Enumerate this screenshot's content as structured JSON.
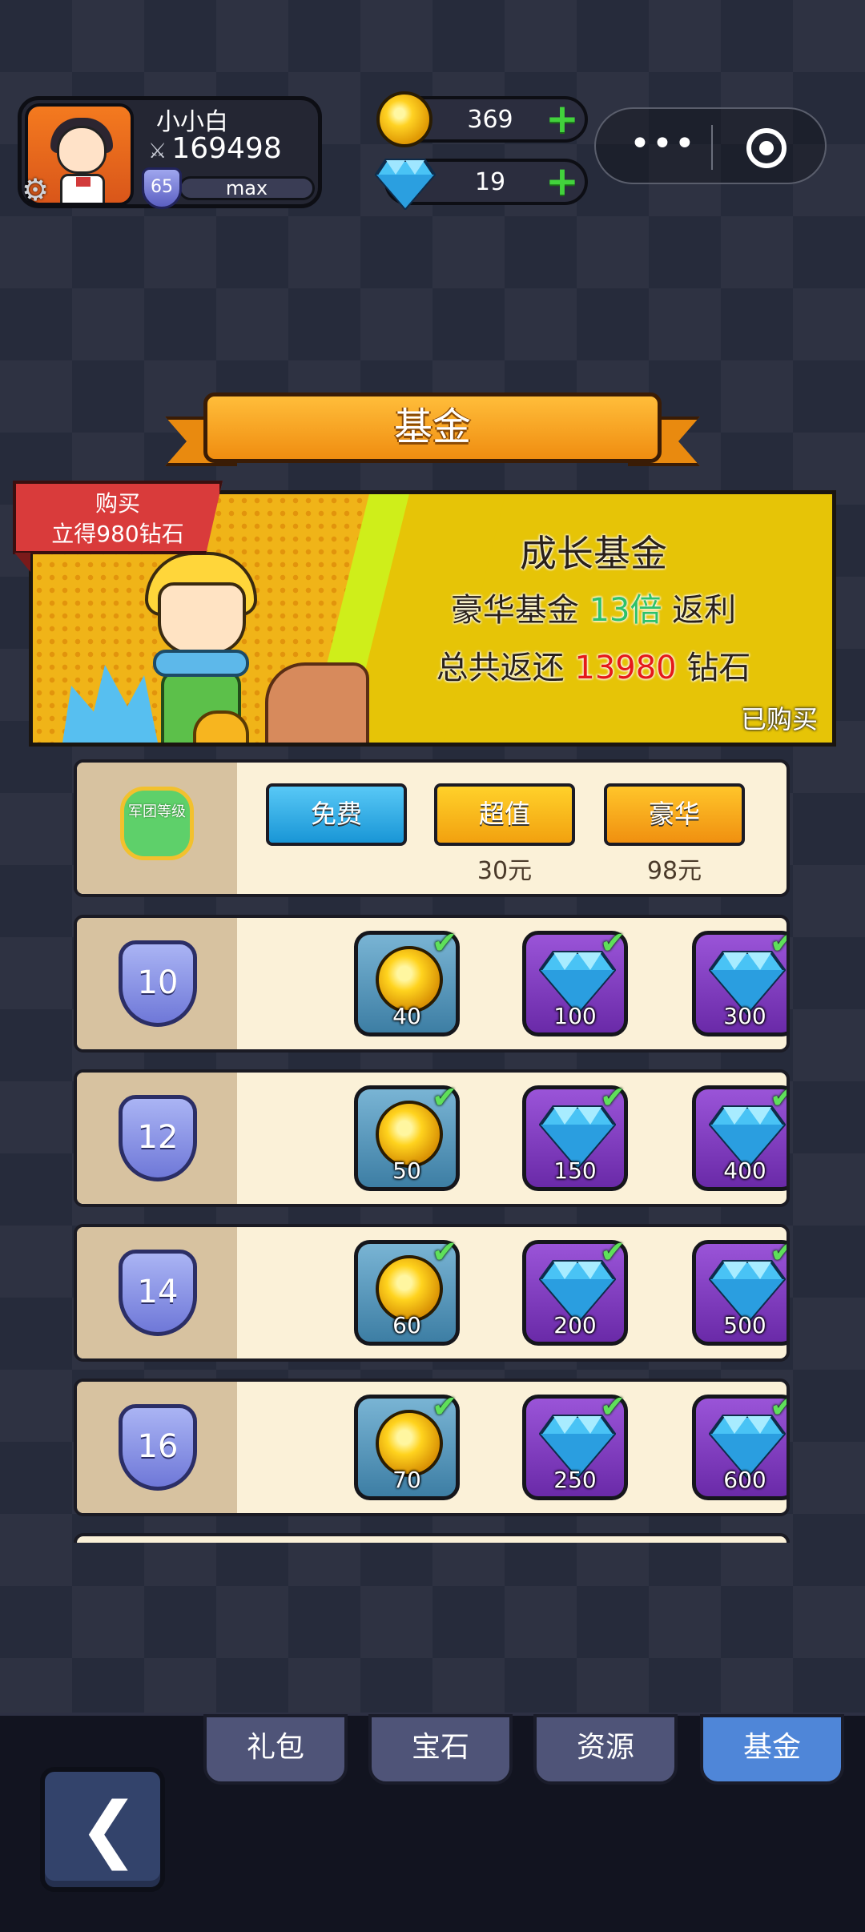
{
  "profile": {
    "name": "小小白",
    "power": "169498",
    "level": "65",
    "exp_label": "max"
  },
  "currencies": {
    "gold": "369",
    "gem": "19"
  },
  "title": "基金",
  "banner": {
    "tag_line1": "购买",
    "tag_line2": "立得980钻石",
    "title": "成长基金",
    "line1_prefix": "豪华基金 ",
    "line1_highlight": "13倍",
    "line1_suffix": " 返利",
    "line2_prefix": "总共返还 ",
    "line2_highlight": "13980",
    "line2_suffix": " 钻石",
    "status": "已购买",
    "colors": {
      "green": "#2ec16a",
      "red": "#e51919"
    }
  },
  "header": {
    "emblem_label": "军团等级",
    "tiers": [
      {
        "label": "免费",
        "price": ""
      },
      {
        "label": "超值",
        "price": "30元"
      },
      {
        "label": "豪华",
        "price": "98元"
      }
    ]
  },
  "rows": [
    {
      "level": "10",
      "rewards": [
        {
          "type": "gold",
          "amount": "40",
          "claimed": true
        },
        {
          "type": "gem",
          "amount": "100",
          "claimed": true
        },
        {
          "type": "gem",
          "amount": "300",
          "claimed": true
        }
      ]
    },
    {
      "level": "12",
      "rewards": [
        {
          "type": "gold",
          "amount": "50",
          "claimed": true
        },
        {
          "type": "gem",
          "amount": "150",
          "claimed": true
        },
        {
          "type": "gem",
          "amount": "400",
          "claimed": true
        }
      ]
    },
    {
      "level": "14",
      "rewards": [
        {
          "type": "gold",
          "amount": "60",
          "claimed": true
        },
        {
          "type": "gem",
          "amount": "200",
          "claimed": true
        },
        {
          "type": "gem",
          "amount": "500",
          "claimed": true
        }
      ]
    },
    {
      "level": "16",
      "rewards": [
        {
          "type": "gold",
          "amount": "70",
          "claimed": true
        },
        {
          "type": "gem",
          "amount": "250",
          "claimed": true
        },
        {
          "type": "gem",
          "amount": "600",
          "claimed": true
        }
      ]
    }
  ],
  "tabs": [
    {
      "label": "礼包",
      "active": false
    },
    {
      "label": "宝石",
      "active": false
    },
    {
      "label": "资源",
      "active": false
    },
    {
      "label": "基金",
      "active": true
    }
  ],
  "icons": {
    "back": "chevron-left-icon",
    "more": "more-dots-icon",
    "close": "target-icon",
    "settings": "gear-icon"
  }
}
